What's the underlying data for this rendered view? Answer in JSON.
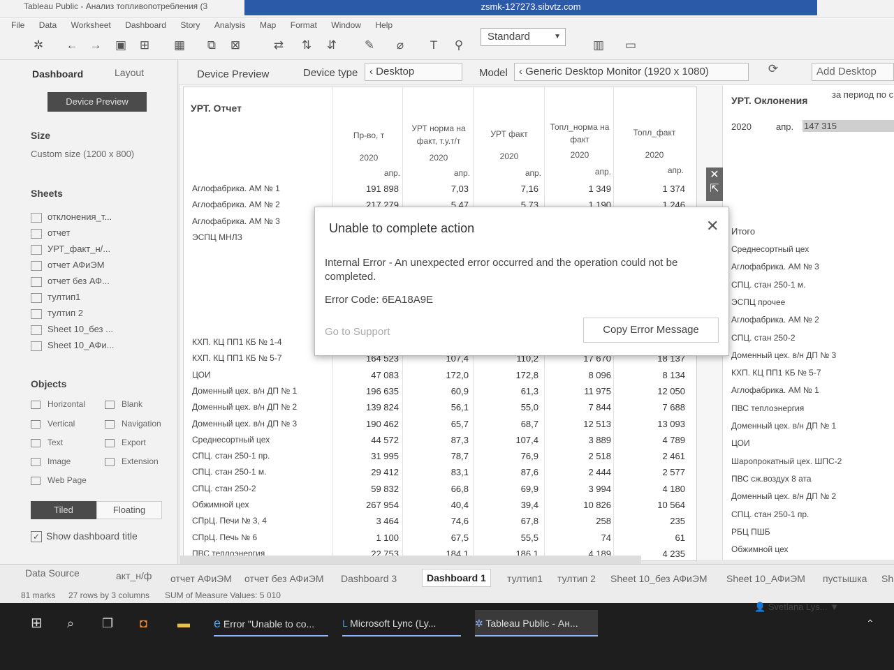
{
  "window": {
    "title": "Tableau Public - Анализ топливопотребления (3",
    "remote_bar": "zsmk-127273.sibvtz.com"
  },
  "menu": [
    "File",
    "Data",
    "Worksheet",
    "Dashboard",
    "Story",
    "Analysis",
    "Map",
    "Format",
    "Window",
    "Help"
  ],
  "toolbar": {
    "fit_mode": "Standard"
  },
  "left_pane": {
    "tab_dashboard": "Dashboard",
    "tab_layout": "Layout",
    "device_preview_button": "Device Preview",
    "size_label": "Size",
    "size_value": "Custom size (1200 x 800)",
    "sheets_label": "Sheets",
    "sheets": [
      "отклонения_т...",
      "отчет",
      "УРТ_факт_н/...",
      "отчет АФиЭМ",
      "отчет без АФ...",
      "тултип1",
      "тултип 2",
      "Sheet 10_без ...",
      "Sheet 10_АФи..."
    ],
    "objects_label": "Objects",
    "objects": [
      "Horizontal",
      "Blank",
      "Vertical",
      "Navigation",
      "Text",
      "Export",
      "Image",
      "Extension",
      "Web Page"
    ],
    "tiled": "Tiled",
    "floating": "Floating",
    "show_title": "Show dashboard title"
  },
  "device_bar": {
    "preview_label": "Device Preview",
    "device_type_label": "Device type",
    "device_type": "Desktop",
    "model_label": "Model",
    "model": "Generic Desktop Monitor (1920 x 1080)",
    "add_layout": "Add Desktop"
  },
  "report": {
    "title": "УРТ. Отчет",
    "headers": [
      "Пр-во, т",
      "УРТ норма на факт, т.у.т/т",
      "УРТ факт",
      "Топл_норма на факт",
      "Топл_факт"
    ],
    "year": "2020",
    "month": "апр.",
    "top_rows": [
      {
        "name": "Аглофабрика. АМ № 1",
        "values": [
          "191 898",
          "7,03",
          "7,16",
          "1 349",
          "1 374"
        ]
      },
      {
        "name": "Аглофабрика. АМ № 2",
        "values": [
          "217 279",
          "5,47",
          "5,73",
          "1 190",
          "1 246"
        ]
      },
      {
        "name": "Аглофабрика. АМ № 3",
        "values": [
          "",
          "",
          "",
          "",
          ""
        ]
      },
      {
        "name": "ЭСПЦ МНЛЗ",
        "values": [
          "",
          "",
          "",
          "",
          ""
        ]
      }
    ],
    "rows": [
      {
        "name": "КХП. КЦ ПП1 КБ № 1-4",
        "values": [
          "",
          "",
          "",
          "",
          ""
        ]
      },
      {
        "name": "КХП. КЦ ПП1 КБ № 5-7",
        "values": [
          "164 523",
          "107,4",
          "110,2",
          "17 670",
          "18 137"
        ]
      },
      {
        "name": "ЦОИ",
        "values": [
          "47 083",
          "172,0",
          "172,8",
          "8 096",
          "8 134"
        ]
      },
      {
        "name": "Доменный цех. в/н ДП № 1",
        "values": [
          "196 635",
          "60,9",
          "61,3",
          "11 975",
          "12 050"
        ]
      },
      {
        "name": "Доменный цех. в/н ДП № 2",
        "values": [
          "139 824",
          "56,1",
          "55,0",
          "7 844",
          "7 688"
        ]
      },
      {
        "name": "Доменный цех. в/н ДП № 3",
        "values": [
          "190 462",
          "65,7",
          "68,7",
          "12 513",
          "13 093"
        ]
      },
      {
        "name": "Среднесортный цех",
        "values": [
          "44 572",
          "87,3",
          "107,4",
          "3 889",
          "4 789"
        ]
      },
      {
        "name": "СПЦ. стан 250-1 пр.",
        "values": [
          "31 995",
          "78,7",
          "76,9",
          "2 518",
          "2 461"
        ]
      },
      {
        "name": "СПЦ. стан 250-1 м.",
        "values": [
          "29 412",
          "83,1",
          "87,6",
          "2 444",
          "2 577"
        ]
      },
      {
        "name": "СПЦ. стан 250-2",
        "values": [
          "59 832",
          "66,8",
          "69,9",
          "3 994",
          "4 180"
        ]
      },
      {
        "name": "Обжимной цех",
        "values": [
          "267 954",
          "40,4",
          "39,4",
          "10 826",
          "10 564"
        ]
      },
      {
        "name": "СПрЦ. Печи № 3, 4",
        "values": [
          "3 464",
          "74,6",
          "67,8",
          "258",
          "235"
        ]
      },
      {
        "name": "СПрЦ. Печь № 6",
        "values": [
          "1 100",
          "67,5",
          "55,5",
          "74",
          "61"
        ]
      },
      {
        "name": "ПВС теплоэнергия",
        "values": [
          "22 753",
          "184,1",
          "186,1",
          "4 189",
          "4 235"
        ]
      }
    ]
  },
  "deviations": {
    "title": "УРТ. Оклонения",
    "period": "за период по с",
    "year": "2020",
    "month": "апр.",
    "value": "147 315",
    "total_label": "Итого",
    "items": [
      "Среднесортный цех",
      "Аглофабрика. АМ № 3",
      "СПЦ. стан 250-1 м.",
      "ЭСПЦ прочее",
      "Аглофабрика. АМ № 2",
      "СПЦ. стан 250-2",
      "Доменный цех. в/н ДП № 3",
      "КХП. КЦ ПП1 КБ № 5-7",
      "Аглофабрика. АМ № 1",
      "ПВС теплоэнергия",
      "Доменный цех. в/н ДП № 1",
      "ЦОИ",
      "Шаропрокатный цех. ШПС-2",
      "ПВС сж.воздух 8 ата",
      "Доменный цех. в/н ДП № 2",
      "СПЦ. стан 250-1 пр.",
      "РБЦ ПШБ",
      "Обжимной цех"
    ]
  },
  "dialog": {
    "title": "Unable to complete action",
    "message": "Internal Error - An unexpected error occurred and the operation could not be completed.",
    "code": "Error Code: 6EA18A9E",
    "support": "Go to Support",
    "copy": "Copy Error Message"
  },
  "tabs": [
    "Data Source",
    "акт_н/ф",
    "отчет АФиЭМ",
    "отчет без АФиЭМ",
    "Dashboard 3",
    "Dashboard 1",
    "тултип1",
    "тултип 2",
    "Sheet 10_без АФиЭМ",
    "Sheet 10_АФиЭМ",
    "пустышка",
    "Sh"
  ],
  "status": {
    "marks": "81 marks",
    "rows": "27 rows by 3 columns",
    "sum": "SUM of Measure Values: 5 010"
  },
  "user": "Svetlana Lys...",
  "taskbar": {
    "item1": "Error \"Unable to co...",
    "item2": "Microsoft Lync (Ly...",
    "item3": "Tableau Public - Ан..."
  }
}
